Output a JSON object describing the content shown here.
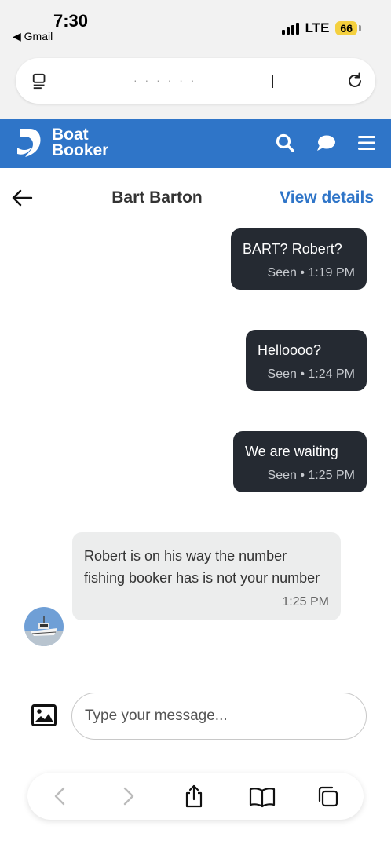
{
  "status_bar": {
    "time": "7:30",
    "back_app": "◀ Gmail",
    "network": "LTE",
    "battery": "66"
  },
  "address_bar": {
    "url_text": "· · ·   · · ·"
  },
  "app_header": {
    "brand_line1": "Boat",
    "brand_line2": "Booker",
    "brand_color": "#2f75c8",
    "icons": [
      "search-icon",
      "chat-icon",
      "menu-icon"
    ]
  },
  "conversation": {
    "title": "Bart Barton",
    "view_details": "View details"
  },
  "messages": [
    {
      "direction": "outgoing",
      "text": "BART? Robert?",
      "meta": "Seen • 1:19 PM"
    },
    {
      "direction": "outgoing",
      "text": "Helloooo?",
      "meta": "Seen • 1:24 PM"
    },
    {
      "direction": "outgoing",
      "text": "We are waiting",
      "meta": "Seen • 1:25 PM"
    },
    {
      "direction": "incoming",
      "text": "Robert is on his way the number fishing booker has is not your number",
      "meta": "1:25 PM"
    }
  ],
  "compose": {
    "placeholder": "Type your message..."
  },
  "colors": {
    "outgoing_bubble": "#252a32",
    "incoming_bubble": "#eceded",
    "accent": "#2f75c8"
  }
}
